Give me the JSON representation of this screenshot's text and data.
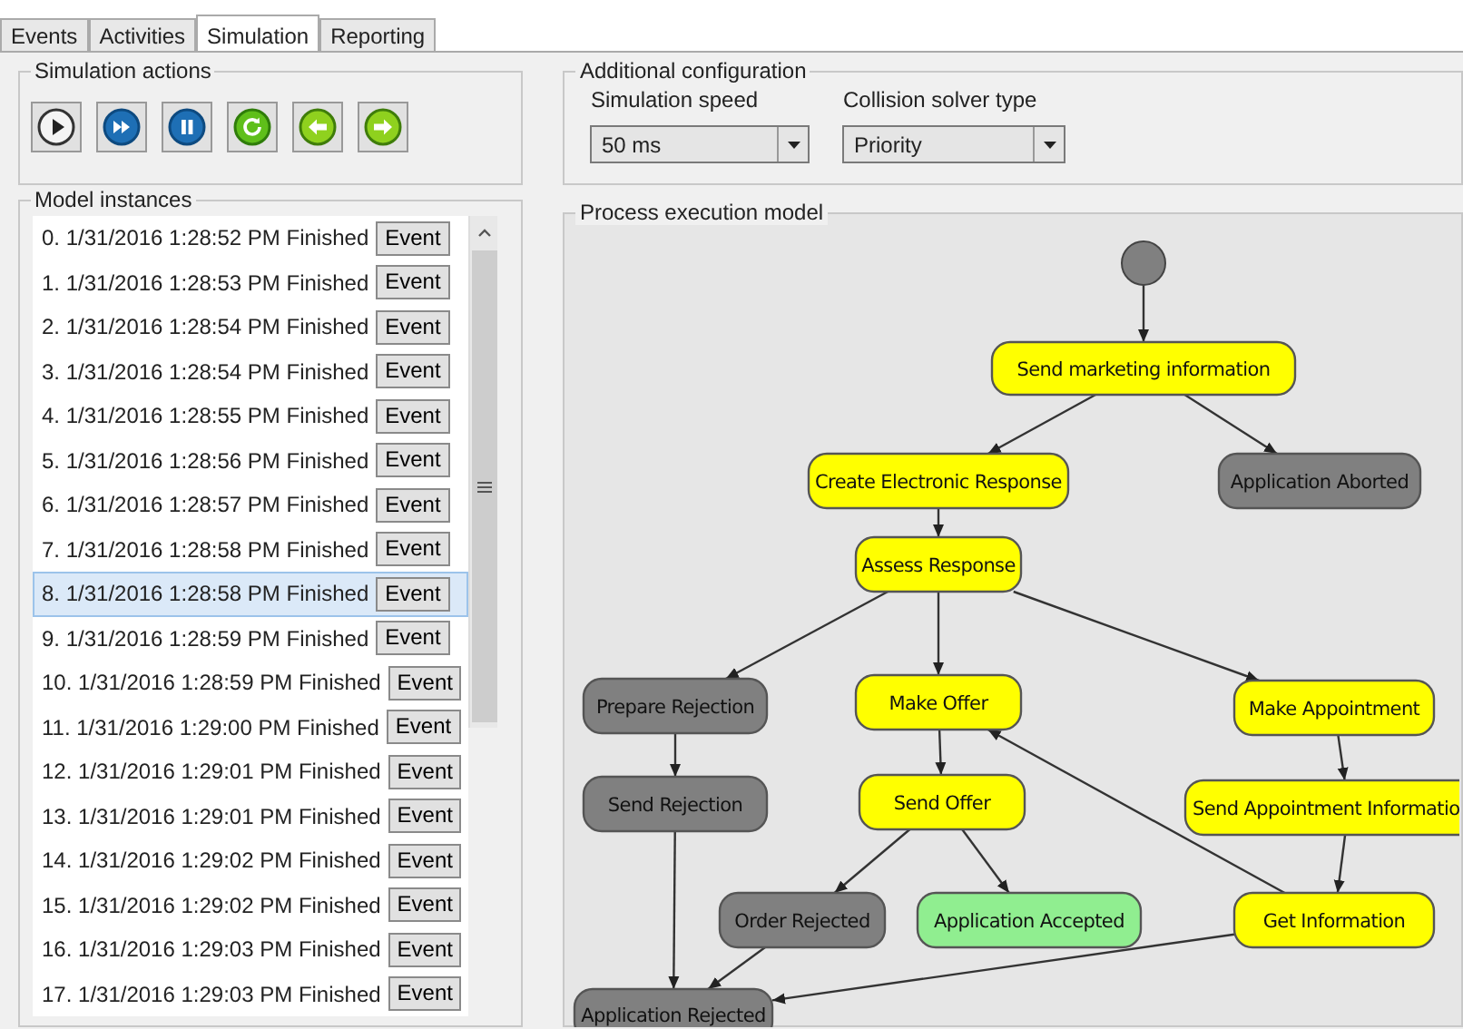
{
  "tabs": [
    {
      "label": "Events",
      "selected": false
    },
    {
      "label": "Activities",
      "selected": false
    },
    {
      "label": "Simulation",
      "selected": true
    },
    {
      "label": "Reporting",
      "selected": false
    }
  ],
  "simulation_actions": {
    "title": "Simulation actions",
    "buttons": [
      {
        "kind": "play"
      },
      {
        "kind": "fast_forward"
      },
      {
        "kind": "pause"
      },
      {
        "kind": "refresh"
      },
      {
        "kind": "back"
      },
      {
        "kind": "forward"
      }
    ]
  },
  "model_instances": {
    "title": "Model instances",
    "items": [
      {
        "label": "0. 1/31/2016 1:28:52 PM Finished",
        "button": "Event",
        "selected": false
      },
      {
        "label": "1. 1/31/2016 1:28:53 PM Finished",
        "button": "Event",
        "selected": false
      },
      {
        "label": "2. 1/31/2016 1:28:54 PM Finished",
        "button": "Event",
        "selected": false
      },
      {
        "label": "3. 1/31/2016 1:28:54 PM Finished",
        "button": "Event",
        "selected": false
      },
      {
        "label": "4. 1/31/2016 1:28:55 PM Finished",
        "button": "Event",
        "selected": false
      },
      {
        "label": "5. 1/31/2016 1:28:56 PM Finished",
        "button": "Event",
        "selected": false
      },
      {
        "label": "6. 1/31/2016 1:28:57 PM Finished",
        "button": "Event",
        "selected": false
      },
      {
        "label": "7. 1/31/2016 1:28:58 PM Finished",
        "button": "Event",
        "selected": false
      },
      {
        "label": "8. 1/31/2016 1:28:58 PM Finished",
        "button": "Event",
        "selected": true
      },
      {
        "label": "9. 1/31/2016 1:28:59 PM Finished",
        "button": "Event",
        "selected": false
      },
      {
        "label": "10. 1/31/2016 1:28:59 PM Finished",
        "button": "Event",
        "selected": false
      },
      {
        "label": "11. 1/31/2016 1:29:00 PM Finished",
        "button": "Event",
        "selected": false
      },
      {
        "label": "12. 1/31/2016 1:29:01 PM Finished",
        "button": "Event",
        "selected": false
      },
      {
        "label": "13. 1/31/2016 1:29:01 PM Finished",
        "button": "Event",
        "selected": false
      },
      {
        "label": "14. 1/31/2016 1:29:02 PM Finished",
        "button": "Event",
        "selected": false
      },
      {
        "label": "15. 1/31/2016 1:29:02 PM Finished",
        "button": "Event",
        "selected": false
      },
      {
        "label": "16. 1/31/2016 1:29:03 PM Finished",
        "button": "Event",
        "selected": false
      },
      {
        "label": "17. 1/31/2016 1:29:03 PM Finished",
        "button": "Event",
        "selected": false
      }
    ]
  },
  "additional_configuration": {
    "title": "Additional configuration",
    "fields": [
      {
        "label": "Simulation speed",
        "value": "50 ms"
      },
      {
        "label": "Collision solver type",
        "value": "Priority"
      }
    ]
  },
  "process_execution_model": {
    "title": "Process execution model",
    "nodes": [
      {
        "kind": "start",
        "color": "#808080"
      },
      {
        "kind": "activity",
        "label": "Send marketing information",
        "color": "#ffff00"
      },
      {
        "kind": "activity",
        "label": "Create Electronic Response",
        "color": "#ffff00"
      },
      {
        "kind": "activity",
        "label": "Application Aborted",
        "color": "#808080"
      },
      {
        "kind": "activity",
        "label": "Assess Response",
        "color": "#ffff00"
      },
      {
        "kind": "activity",
        "label": "Prepare Rejection",
        "color": "#808080"
      },
      {
        "kind": "activity",
        "label": "Make Offer",
        "color": "#ffff00"
      },
      {
        "kind": "activity",
        "label": "Make Appointment",
        "color": "#ffff00"
      },
      {
        "kind": "activity",
        "label": "Send Rejection",
        "color": "#808080"
      },
      {
        "kind": "activity",
        "label": "Send Offer",
        "color": "#ffff00"
      },
      {
        "kind": "activity",
        "label": "Send Appointment Informatio",
        "color": "#ffff00"
      },
      {
        "kind": "activity",
        "label": "Order Rejected",
        "color": "#808080"
      },
      {
        "kind": "activity",
        "label": "Application Accepted",
        "color": "#90ee90"
      },
      {
        "kind": "activity",
        "label": "Get Information",
        "color": "#ffff00"
      },
      {
        "kind": "activity",
        "label": "Application Rejected",
        "color": "#808080"
      }
    ]
  }
}
